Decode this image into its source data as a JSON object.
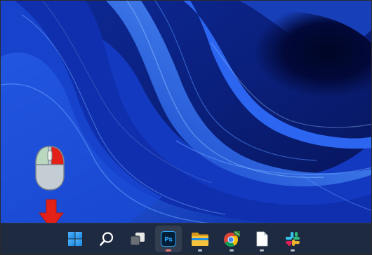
{
  "desktop": {
    "wallpaper": "windows-11-bloom-blue"
  },
  "annotation": {
    "mouse_icon": "mouse-right-click-icon",
    "arrow_icon": "red-down-arrow-icon",
    "arrow_color": "#e32119",
    "right_button_color": "#e32119",
    "left_button_color": "#b9d8bf"
  },
  "taskbar": {
    "background": "#1e2a3f",
    "items": [
      {
        "name": "start",
        "icon": "windows-logo-icon",
        "indicator": false,
        "active": false
      },
      {
        "name": "search",
        "icon": "search-icon",
        "indicator": false,
        "active": false
      },
      {
        "name": "task-view",
        "icon": "task-view-icon",
        "indicator": false,
        "active": false
      },
      {
        "name": "photoshop",
        "icon": "photoshop-icon",
        "label": "Ps",
        "indicator": true,
        "active": true
      },
      {
        "name": "file-explorer",
        "icon": "folder-icon",
        "indicator": true,
        "active": false
      },
      {
        "name": "chrome",
        "icon": "chrome-icon",
        "indicator": true,
        "active": false
      },
      {
        "name": "notepad",
        "icon": "document-icon",
        "indicator": true,
        "active": false
      },
      {
        "name": "slack",
        "icon": "slack-icon",
        "indicator": true,
        "active": false
      }
    ]
  }
}
